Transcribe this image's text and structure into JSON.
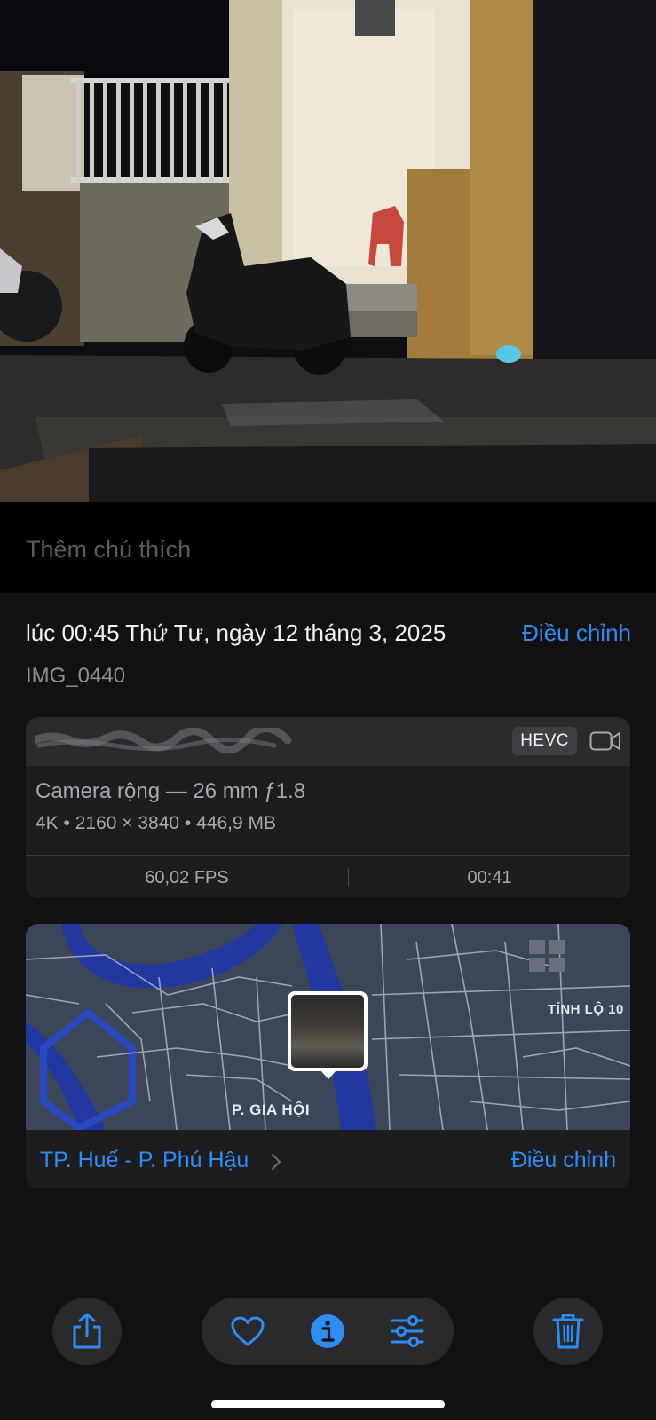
{
  "caption": {
    "placeholder": "Thêm chú thích"
  },
  "info": {
    "datetime": "lúc 00:45 Thứ Tư, ngày 12 tháng 3, 2025",
    "adjust_label": "Điều chỉnh",
    "filename": "IMG_0440"
  },
  "camera": {
    "format_badge": "HEVC",
    "lens": "Camera rộng — 26 mm ƒ1.8",
    "specs": "4K • 2160 × 3840 • 446,9 MB",
    "fps": "60,02 FPS",
    "duration": "00:41"
  },
  "map": {
    "labels": {
      "ward": "P. GIA HỘI",
      "road": "TỈNH LỘ 10"
    },
    "place": "TP. Huế - P. Phú Hậu",
    "adjust_label": "Điều chỉnh"
  },
  "toolbar": {
    "share_icon": "share-icon",
    "favorite_icon": "heart-icon",
    "info_icon": "info-icon",
    "edit_icon": "sliders-icon",
    "delete_icon": "trash-icon"
  },
  "colors": {
    "accent": "#2E8CF5",
    "sheet": "#121214",
    "card": "#1D1D20",
    "river": "#2238A0"
  }
}
